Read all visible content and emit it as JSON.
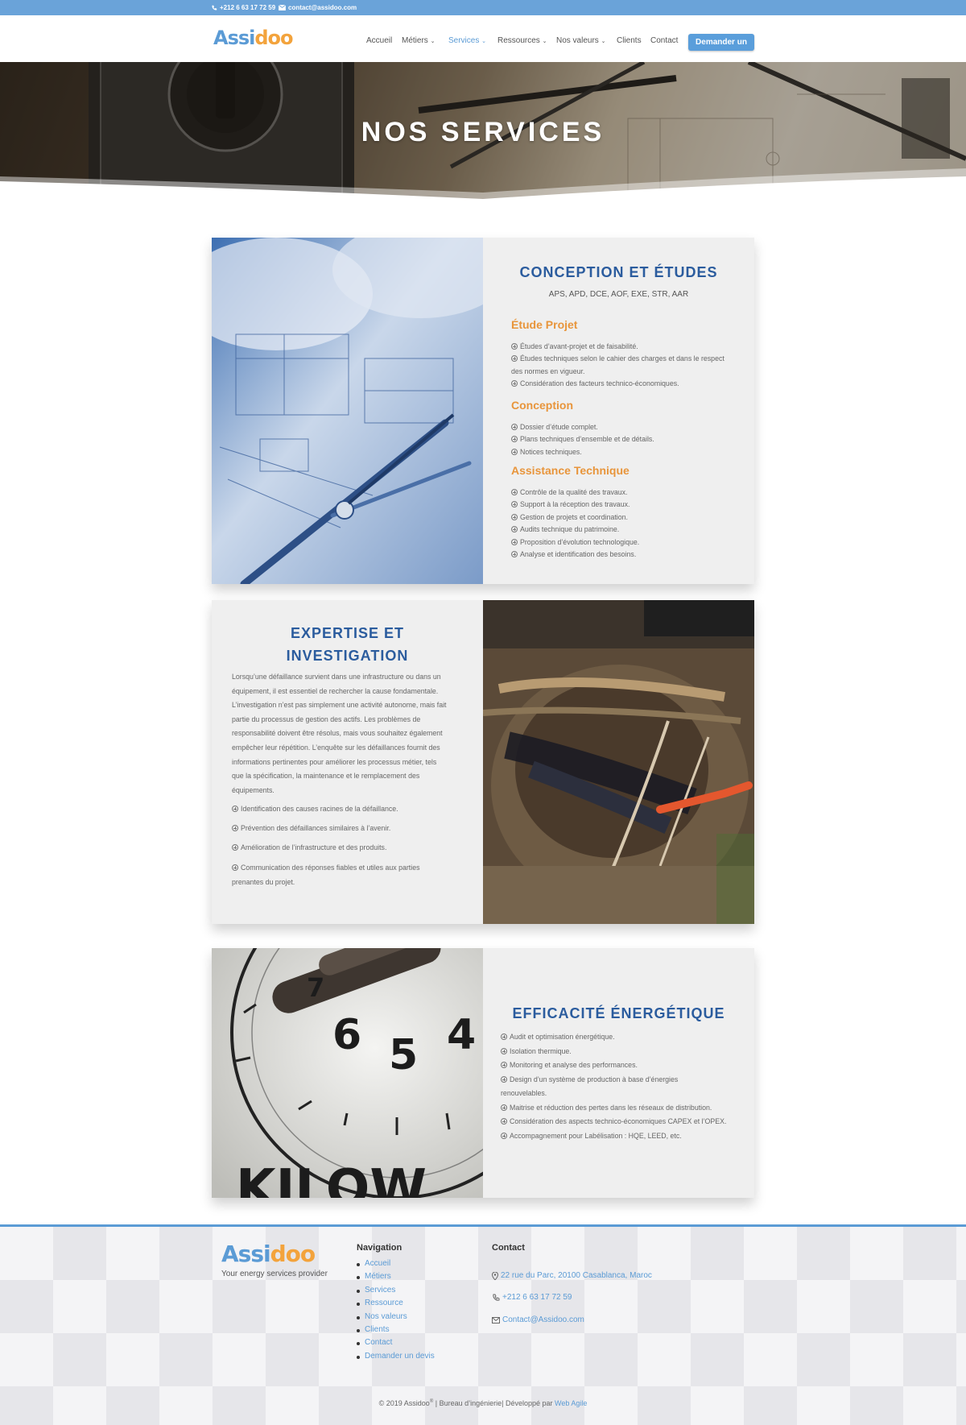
{
  "topbar": {
    "phone": "+212 6 63 17 72 59",
    "email": "contact@assidoo.com"
  },
  "brand": {
    "logo_a": "Assi",
    "logo_b": "doo",
    "tagline": "Your energy services provider"
  },
  "nav": {
    "items": [
      {
        "label": "Accueil"
      },
      {
        "label": "Métiers"
      },
      {
        "label": "Services",
        "active": true
      },
      {
        "label": "Ressources"
      },
      {
        "label": "Nos valeurs"
      },
      {
        "label": "Clients"
      },
      {
        "label": "Contact"
      }
    ],
    "cta": "Demander un devis"
  },
  "hero": {
    "title": "NOS SERVICES"
  },
  "conception": {
    "title": "CONCEPTION ET ÉTUDES",
    "subtitle": "APS, APD, DCE, AOF, EXE, STR, AAR",
    "sections": [
      {
        "title": "Étude Projet",
        "items": [
          "Études d’avant-projet et de faisabilité.",
          "Études techniques selon le cahier des charges et dans le respect",
          "des normes en vigueur.",
          "Considération des facteurs technico-économiques."
        ]
      },
      {
        "title": "Conception",
        "items": [
          "Dossier d’étude complet.",
          "Plans techniques d’ensemble et de détails.",
          "Notices techniques."
        ]
      },
      {
        "title": "Assistance Technique",
        "items": [
          "Contrôle de la qualité des travaux.",
          "Support à la réception des travaux.",
          "Gestion de projets et coordination.",
          "Audits technique du patrimoine.",
          "Proposition d’évolution technologique.",
          "Analyse et identification des besoins."
        ]
      }
    ]
  },
  "expertise": {
    "title_1": "EXPERTISE ET",
    "title_2": "INVESTIGATION",
    "paragraph": [
      "Lorsqu’une défaillance survient dans une infrastructure ou dans un",
      "équipement, il est essentiel de rechercher la cause fondamentale.",
      "L’investigation n’est pas simplement une activité autonome, mais fait",
      "partie du processus de gestion des actifs. Les problèmes de",
      "responsabilité doivent être résolus, mais vous souhaitez également",
      "empêcher leur répétition. L’enquête sur les défaillances fournit des",
      "informations pertinentes pour améliorer les processus métier, tels",
      "que la spécification, la maintenance et le remplacement des",
      "équipements."
    ],
    "items": [
      "Identification des causes racines de la défaillance.",
      "Prévention des défaillances similaires à l’avenir.",
      "Amélioration de l’infrastructure et des produits.",
      "Communication des réponses fiables et utiles aux parties",
      "prenantes du projet."
    ]
  },
  "efficacite": {
    "title": "EFFICACITÉ ÉNERGÉTIQUE",
    "items": [
      "Audit et optimisation énergétique.",
      "Isolation thermique.",
      "Monitoring et analyse des performances.",
      "Design d’un système de production à base d’énergies",
      "renouvelables.",
      "Maitrise et réduction des pertes dans les réseaux de distribution.",
      "Considération des aspects technico-économiques CAPEX et l’OPEX.",
      "Accompagnement pour Labélisation : HQE, LEED, etc."
    ],
    "meter_digits": [
      "7",
      "6",
      "5",
      "4"
    ],
    "meter_word": "KILOW"
  },
  "footer": {
    "nav_title": "Navigation",
    "nav_items": [
      "Accueil",
      "Métiers",
      "Services",
      "Ressource",
      "Nos valeurs",
      "Clients",
      "Contact",
      "Demander un devis"
    ],
    "contact_title": "Contact",
    "address": "22 rue du Parc, 20100 Casablanca, Maroc",
    "phone": "+212 6 63 17 72 59",
    "email": "Contact@Assidoo.com",
    "copyright": "© 2019 Assidoo",
    "reg": "®",
    "copyright_rest": " | Bureau d’ingénierie| Développé par ",
    "dev": "Web Agile"
  },
  "colors": {
    "topbar": "#6aa3d9",
    "accent_blue": "#5b9bd5",
    "title_blue": "#2b5c9e",
    "orange": "#e8953b",
    "card_bg": "#efefef"
  }
}
